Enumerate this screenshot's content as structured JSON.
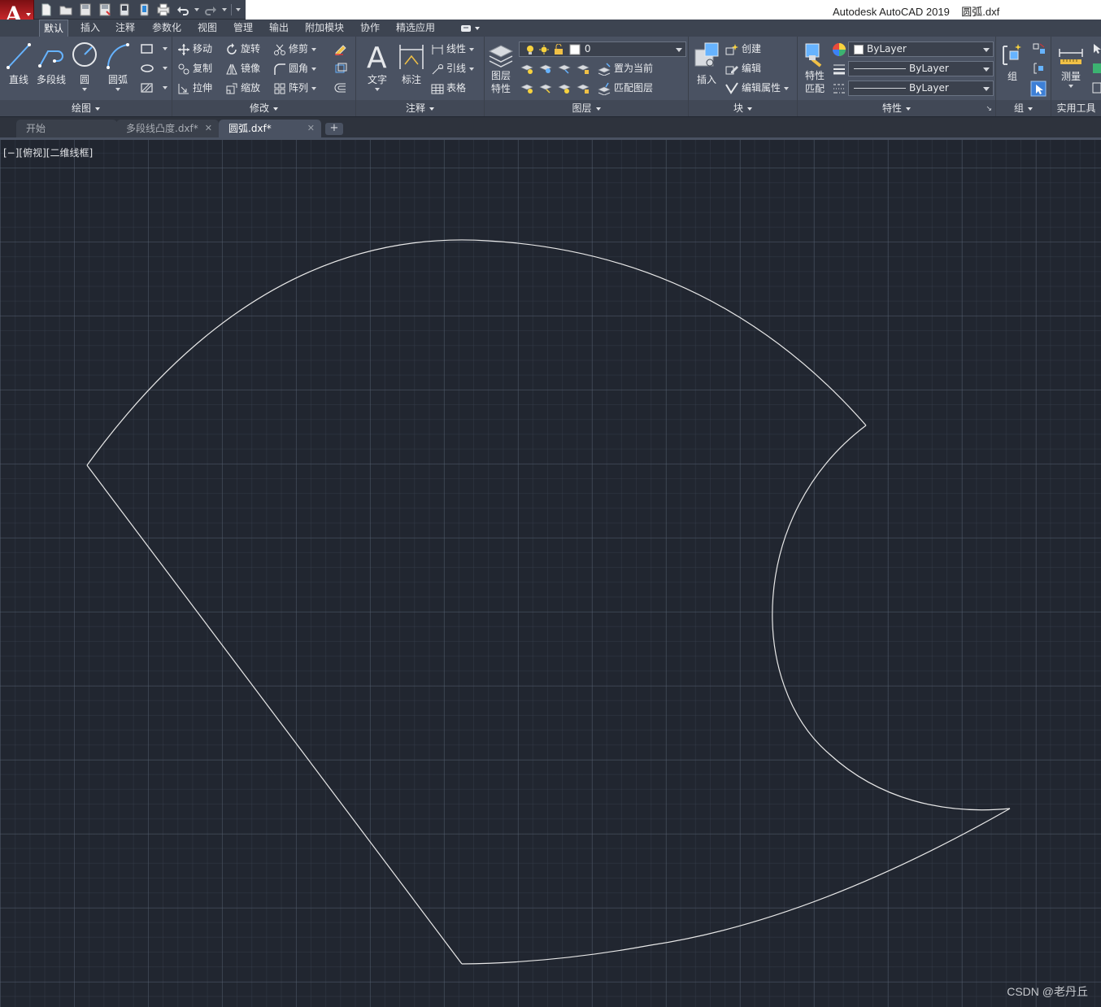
{
  "title_bar": {
    "app_name": "Autodesk AutoCAD 2019",
    "file_name": "圆弧.dxf",
    "app_button_letter": "A"
  },
  "quick_access": {
    "buttons": [
      "new-icon",
      "open-icon",
      "save-icon",
      "save-as-icon",
      "web-mobile-open-icon",
      "web-mobile-save-icon",
      "plot-icon",
      "undo-icon",
      "redo-icon"
    ]
  },
  "ribbon_tabs": [
    "默认",
    "插入",
    "注释",
    "参数化",
    "视图",
    "管理",
    "输出",
    "附加模块",
    "协作",
    "精选应用"
  ],
  "active_tab": "默认",
  "panels": {
    "draw": {
      "title": "绘图",
      "line": "直线",
      "polyline": "多段线",
      "circle": "圆",
      "arc": "圆弧"
    },
    "modify": {
      "title": "修改",
      "move": "移动",
      "rotate": "旋转",
      "trim": "修剪",
      "copy": "复制",
      "mirror": "镜像",
      "fillet": "圆角",
      "stretch": "拉伸",
      "scale": "缩放",
      "array": "阵列"
    },
    "annotation": {
      "title": "注释",
      "text": "文字",
      "dimension": "标注",
      "linear": "线性",
      "leader": "引线",
      "table": "表格"
    },
    "layers": {
      "title": "图层",
      "layer_properties_1": "图层",
      "layer_properties_2": "特性",
      "current_layer": "0",
      "set_current": "置为当前",
      "match_layer": "匹配图层"
    },
    "block": {
      "title": "块",
      "insert": "插入",
      "create": "创建",
      "edit": "编辑",
      "edit_attributes": "编辑属性"
    },
    "properties": {
      "title": "特性",
      "match_1": "特性",
      "match_2": "匹配",
      "color": "ByLayer",
      "linetype": "ByLayer",
      "lineweight": "ByLayer"
    },
    "groups": {
      "title": "组",
      "group": "组"
    },
    "utilities": {
      "title": "实用工具",
      "measure": "测量"
    }
  },
  "file_tabs": [
    {
      "label": "开始",
      "closable": false,
      "active": false
    },
    {
      "label": "多段线凸度.dxf*",
      "closable": true,
      "active": false
    },
    {
      "label": "圆弧.dxf*",
      "closable": true,
      "active": true
    }
  ],
  "viewport_controls": "[−][俯视][二维线框]",
  "watermark": "CSDN @老丹丘",
  "colors": {
    "canvas_bg": "#212630",
    "ribbon_bg": "#4a5262",
    "geometry_stroke": "#e8e8e8",
    "brand_red": "#c8262b"
  }
}
